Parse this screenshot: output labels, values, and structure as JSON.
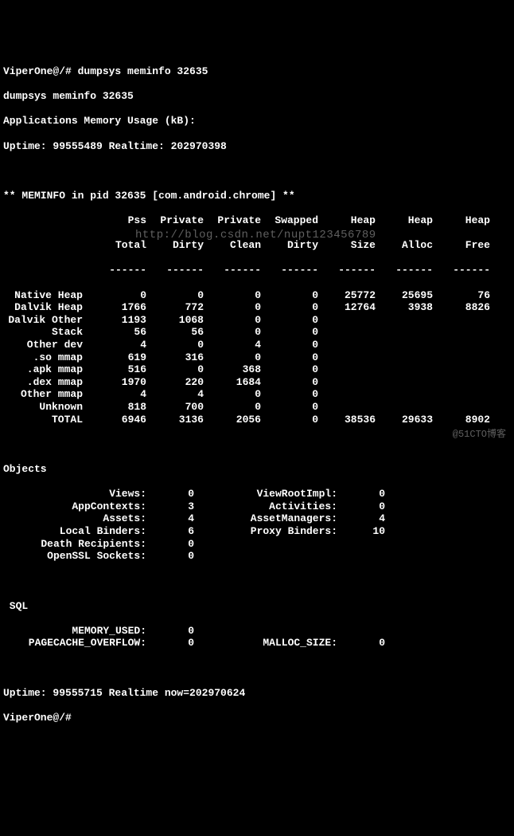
{
  "prompt1": "ViperOne@/# dumpsys meminfo 32635",
  "echo": "dumpsys meminfo 32635",
  "app_header": "Applications Memory Usage (kB):",
  "uptime1": "Uptime: 99555489 Realtime: 202970398",
  "meminfo_header": "** MEMINFO in pid 32635 [com.android.chrome] **",
  "headers": {
    "pss_total1": "Pss",
    "pss_total2": "Total",
    "priv_dirty1": "Private",
    "priv_dirty2": "Dirty",
    "priv_clean1": "Private",
    "priv_clean2": "Clean",
    "swap_dirty1": "Swapped",
    "swap_dirty2": "Dirty",
    "heap_size1": "Heap",
    "heap_size2": "Size",
    "heap_alloc1": "Heap",
    "heap_alloc2": "Alloc",
    "heap_free1": "Heap",
    "heap_free2": "Free"
  },
  "dash": "------",
  "rows": [
    {
      "label": "Native Heap",
      "c1": "0",
      "c2": "0",
      "c3": "0",
      "c4": "0",
      "c5": "25772",
      "c6": "25695",
      "c7": "76"
    },
    {
      "label": "Dalvik Heap",
      "c1": "1766",
      "c2": "772",
      "c3": "0",
      "c4": "0",
      "c5": "12764",
      "c6": "3938",
      "c7": "8826"
    },
    {
      "label": "Dalvik Other",
      "c1": "1193",
      "c2": "1068",
      "c3": "0",
      "c4": "0"
    },
    {
      "label": "Stack",
      "c1": "56",
      "c2": "56",
      "c3": "0",
      "c4": "0"
    },
    {
      "label": "Other dev",
      "c1": "4",
      "c2": "0",
      "c3": "4",
      "c4": "0"
    },
    {
      "label": ".so mmap",
      "c1": "619",
      "c2": "316",
      "c3": "0",
      "c4": "0"
    },
    {
      "label": ".apk mmap",
      "c1": "516",
      "c2": "0",
      "c3": "368",
      "c4": "0"
    },
    {
      "label": ".dex mmap",
      "c1": "1970",
      "c2": "220",
      "c3": "1684",
      "c4": "0"
    },
    {
      "label": "Other mmap",
      "c1": "4",
      "c2": "4",
      "c3": "0",
      "c4": "0"
    },
    {
      "label": "Unknown",
      "c1": "818",
      "c2": "700",
      "c3": "0",
      "c4": "0"
    },
    {
      "label": "TOTAL",
      "c1": "6946",
      "c2": "3136",
      "c3": "2056",
      "c4": "0",
      "c5": "38536",
      "c6": "29633",
      "c7": "8902"
    }
  ],
  "objects_header": "Objects",
  "objects": [
    {
      "l1": "Views:",
      "v1": "0",
      "l2": "ViewRootImpl:",
      "v2": "0"
    },
    {
      "l1": "AppContexts:",
      "v1": "3",
      "l2": "Activities:",
      "v2": "0"
    },
    {
      "l1": "Assets:",
      "v1": "4",
      "l2": "AssetManagers:",
      "v2": "4"
    },
    {
      "l1": "Local Binders:",
      "v1": "6",
      "l2": "Proxy Binders:",
      "v2": "10"
    },
    {
      "l1": "Death Recipients:",
      "v1": "0"
    },
    {
      "l1": "OpenSSL Sockets:",
      "v1": "0"
    }
  ],
  "sql_header": " SQL",
  "sql": [
    {
      "l1": "MEMORY_USED:",
      "v1": "0"
    },
    {
      "l1": "PAGECACHE_OVERFLOW:",
      "v1": "0",
      "l2": "MALLOC_SIZE:",
      "v2": "0"
    }
  ],
  "uptime2": "Uptime: 99555715 Realtime now=202970624",
  "prompt2": "ViperOne@/#",
  "watermark_center": "http://blog.csdn.net/nupt123456789",
  "watermark_br": "@51CTO博客"
}
